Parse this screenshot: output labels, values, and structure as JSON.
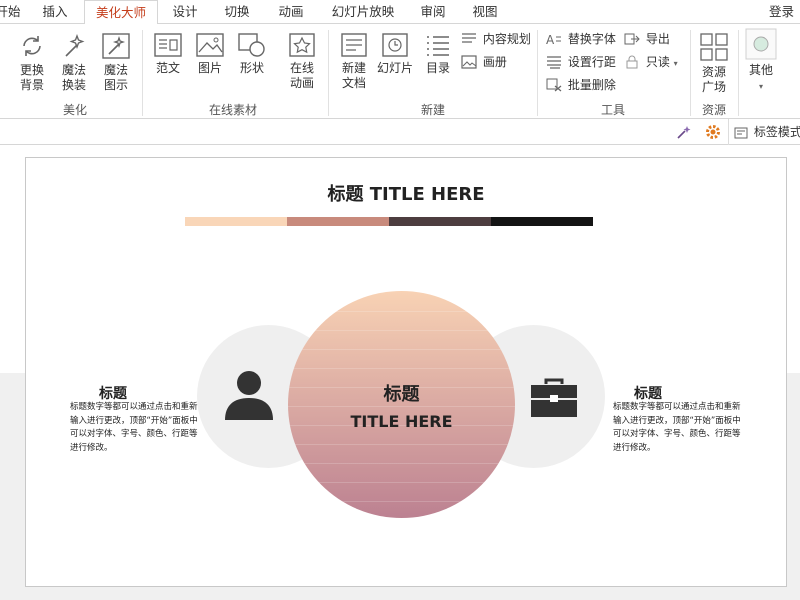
{
  "tabs": [
    {
      "label": "开始",
      "name": "tab-start"
    },
    {
      "label": "插入",
      "name": "tab-insert"
    },
    {
      "label": "美化大师",
      "name": "tab-beautify-master"
    },
    {
      "label": "设计",
      "name": "tab-design"
    },
    {
      "label": "切换",
      "name": "tab-transitions"
    },
    {
      "label": "动画",
      "name": "tab-animations"
    },
    {
      "label": "幻灯片放映",
      "name": "tab-slideshow"
    },
    {
      "label": "审阅",
      "name": "tab-review"
    },
    {
      "label": "视图",
      "name": "tab-view"
    }
  ],
  "login": "登录",
  "ribbon": {
    "beautify": {
      "change_bg": "更换\n背景",
      "magic_change": "魔法\n换装",
      "magic_diagram": "魔法\n图示",
      "label": "美化"
    },
    "online": {
      "template": "范文",
      "picture": "图片",
      "shape": "形状",
      "online_anim": "在线\n动画",
      "label": "在线素材"
    },
    "new": {
      "new_doc": "新建\n文档",
      "slide": "幻灯片",
      "toc": "目录",
      "content_plan": "内容规划",
      "album": "画册",
      "label": "新建"
    },
    "tools": {
      "replace_font": "替换字体",
      "export": "导出",
      "line_spacing": "设置行距",
      "readonly": "只读",
      "batch_delete": "批量删除",
      "label": "工具"
    },
    "resources": {
      "plaza": "资源\n广场",
      "label": "资源"
    },
    "other": {
      "label": "其他"
    }
  },
  "toolbar2": {
    "tag_mode": "标签模式"
  },
  "slide": {
    "title": "标题  TITLE HERE",
    "bar_colors": [
      "#f9d6b8",
      "#c88a7c",
      "#4d3d3f",
      "#141414"
    ],
    "left": {
      "title": "标题",
      "text": "标题数字等都可以通过点击和重新输入进行更改，顶部“开始”面板中可以对字体、字号、颜色、行距等进行修改。"
    },
    "right": {
      "title": "标题",
      "text": "标题数字等都可以通过点击和重新输入进行更改，顶部“开始”面板中可以对字体、字号、颜色、行距等进行修改。"
    },
    "center": {
      "line1": "标题",
      "line2": "TITLE HERE"
    }
  },
  "icons": {
    "left": "user-icon",
    "right": "briefcase-icon"
  }
}
